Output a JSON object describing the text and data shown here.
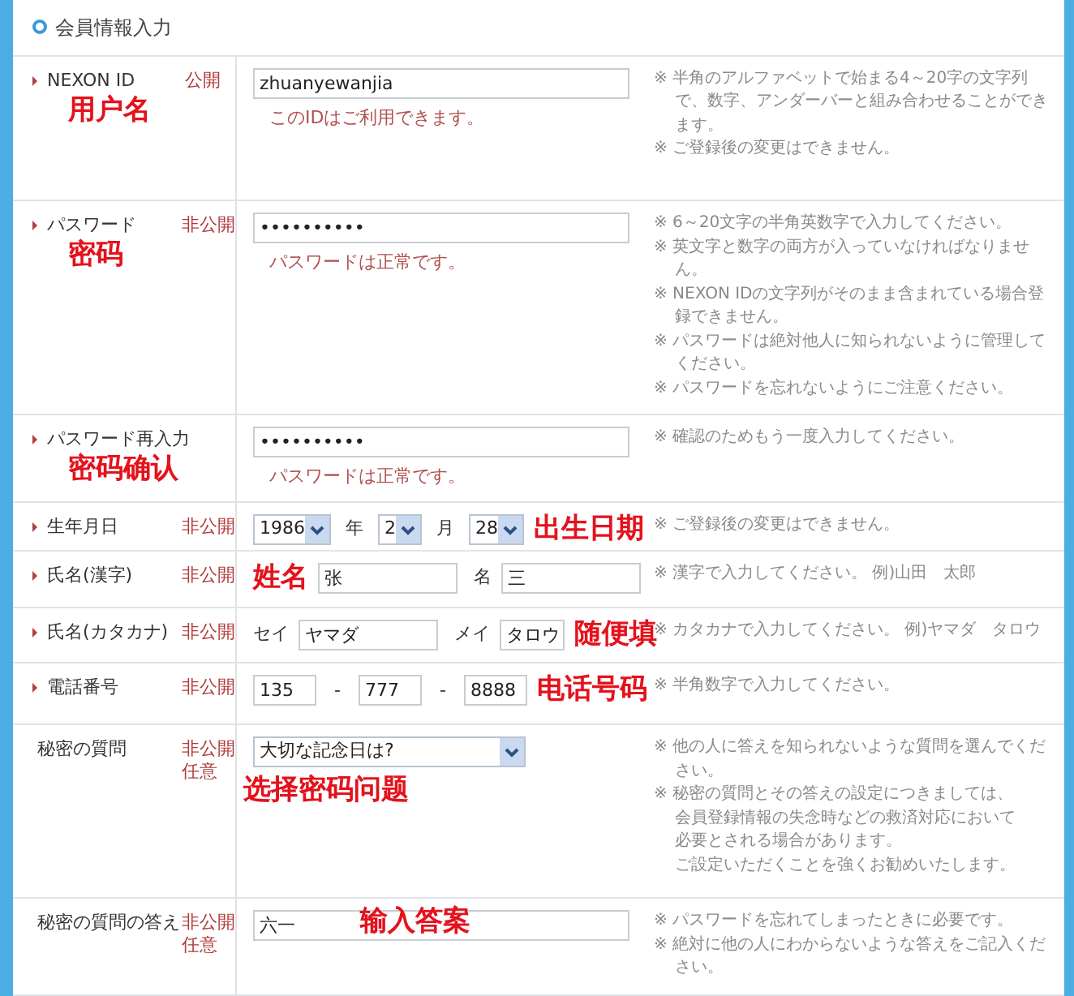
{
  "section_title": "会員情報入力",
  "rows": [
    {
      "kind": "text",
      "bullet": true,
      "label": "NEXON ID",
      "visibility": [
        "公開"
      ],
      "value": "zhuanyewanjia",
      "message": "このIDはご利用できます。",
      "annotation": {
        "text": "用户名",
        "kind": "under_label"
      },
      "notes": [
        "※ 半角のアルファベットで始まる4～20字の文字列で、数字、アンダーバーと組み合わせることができます。",
        "※ ご登録後の変更はできません。"
      ]
    },
    {
      "kind": "text",
      "bullet": true,
      "label": "パスワード",
      "visibility": [
        "非公開"
      ],
      "value": "••••••••••",
      "message": "パスワードは正常です。",
      "annotation": {
        "text": "密码",
        "kind": "under_label"
      },
      "notes": [
        "※ 6～20文字の半角英数字で入力してください。",
        "※ 英文字と数字の両方が入っていなければなりません。",
        "※ NEXON IDの文字列がそのまま含まれている場合登録できません。",
        "※ パスワードは絶対他人に知られないように管理してください。",
        "※ パスワードを忘れないようにご注意ください。"
      ]
    },
    {
      "kind": "text",
      "bullet": true,
      "label": "パスワード再入力",
      "visibility": [],
      "value": "••••••••••",
      "message": "パスワードは正常です。",
      "annotation": {
        "text": "密码确认",
        "kind": "under_label"
      },
      "notes": [
        "※ 確認のためもう一度入力してください。"
      ]
    },
    {
      "kind": "date",
      "bullet": true,
      "label": "生年月日",
      "visibility": [
        "非公開"
      ],
      "selects": [
        {
          "value": "1986",
          "unit": "年"
        },
        {
          "value": "2",
          "unit": "月"
        },
        {
          "value": "28"
        }
      ],
      "annotation": {
        "text": "出生日期",
        "kind": "after_fields"
      },
      "notes": [
        "※ ご登録後の変更はできません。"
      ]
    },
    {
      "kind": "name",
      "bullet": true,
      "label": "氏名(漢字)",
      "visibility": [
        "非公開"
      ],
      "inputs": [
        {
          "value": "张"
        },
        {
          "label": "名",
          "value": "三"
        }
      ],
      "annotation": {
        "text": "姓名",
        "kind": "before_fields"
      },
      "notes": [
        "※ 漢字で入力してください。 例)山田　太郎"
      ]
    },
    {
      "kind": "name",
      "bullet": true,
      "label": "氏名(カタカナ)",
      "visibility": [
        "非公開"
      ],
      "inputs": [
        {
          "label": "セイ",
          "value": "ヤマダ"
        },
        {
          "label": "メイ",
          "value": "タロウ"
        }
      ],
      "annotation": {
        "text": "随便填",
        "kind": "after_fields"
      },
      "notes": [
        "※ カタカナで入力してください。 例)ヤマダ　タロウ"
      ]
    },
    {
      "kind": "phone",
      "bullet": true,
      "label": "電話番号",
      "visibility": [
        "非公開"
      ],
      "inputs": [
        {
          "value": "135"
        },
        {
          "value": "777"
        },
        {
          "value": "8888"
        }
      ],
      "separator": "-",
      "annotation": {
        "text": "电话号码",
        "kind": "after_fields"
      },
      "notes": [
        "※ 半角数字で入力してください。"
      ]
    },
    {
      "kind": "select",
      "bullet": false,
      "label": "秘密の質問",
      "visibility": [
        "非公開",
        "任意"
      ],
      "value": "大切な記念日は?",
      "annotation": {
        "text": "选择密码问题",
        "kind": "under_field"
      },
      "notes": [
        "※ 他の人に答えを知られないような質問を選んでください。",
        "※ 秘密の質問とその答えの設定につきましては、",
        {
          "kind": "continued",
          "text": "会員登録情報の失念時などの救済対応において"
        },
        {
          "kind": "continued",
          "text": "必要とされる場合があります。"
        },
        {
          "kind": "continued",
          "text": "ご設定いただくことを強くお勧めいたします。"
        }
      ]
    },
    {
      "kind": "text",
      "bullet": false,
      "label": "秘密の質問の答え",
      "visibility": [
        "非公開",
        "任意"
      ],
      "value": "六一",
      "annotation": {
        "text": "输入答案",
        "kind": "over_field"
      },
      "notes": [
        "※ パスワードを忘れてしまったときに必要です。",
        "※ 絶対に他の人にわからないような答えをご記入ください。"
      ]
    }
  ]
}
